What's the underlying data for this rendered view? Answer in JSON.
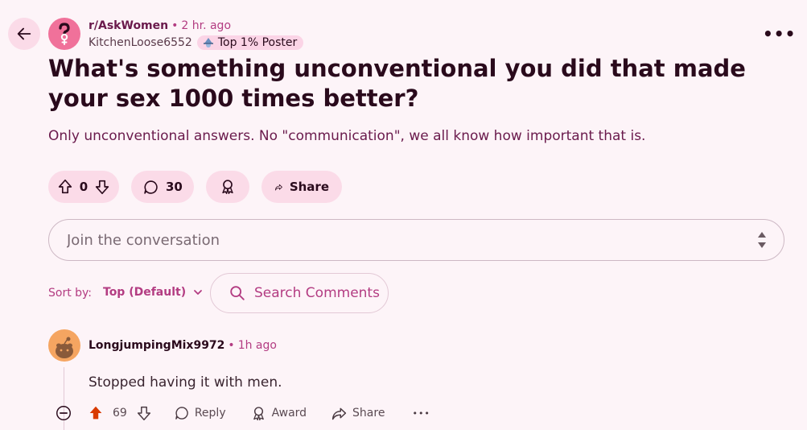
{
  "post": {
    "subreddit": "r/AskWomen",
    "separator": "•",
    "time": "2 hr. ago",
    "author": "KitchenLoose6552",
    "flair": "Top 1% Poster",
    "title": "What's something unconventional you did that made your sex 1000 times better?",
    "body": "Only unconventional answers. No \"communication\", we all know how important that is.",
    "score": "0",
    "comment_count": "30",
    "share_label": "Share",
    "more_label": "•••"
  },
  "composer": {
    "placeholder": "Join the conversation"
  },
  "sort": {
    "label": "Sort by:",
    "value": "Top (Default)",
    "search_label": "Search Comments"
  },
  "comment": {
    "author": "LongjumpingMix9972",
    "separator": "•",
    "time": "1h ago",
    "body": "Stopped having it with men.",
    "score": "69",
    "reply_label": "Reply",
    "award_label": "Award",
    "share_label": "Share",
    "more_label": "•••",
    "upvote_color": "#d93a00"
  },
  "colors": {
    "background": "#fdf4f8",
    "pill": "#fbdbe8",
    "accent": "#b33c82",
    "title": "#2a0a1c"
  }
}
